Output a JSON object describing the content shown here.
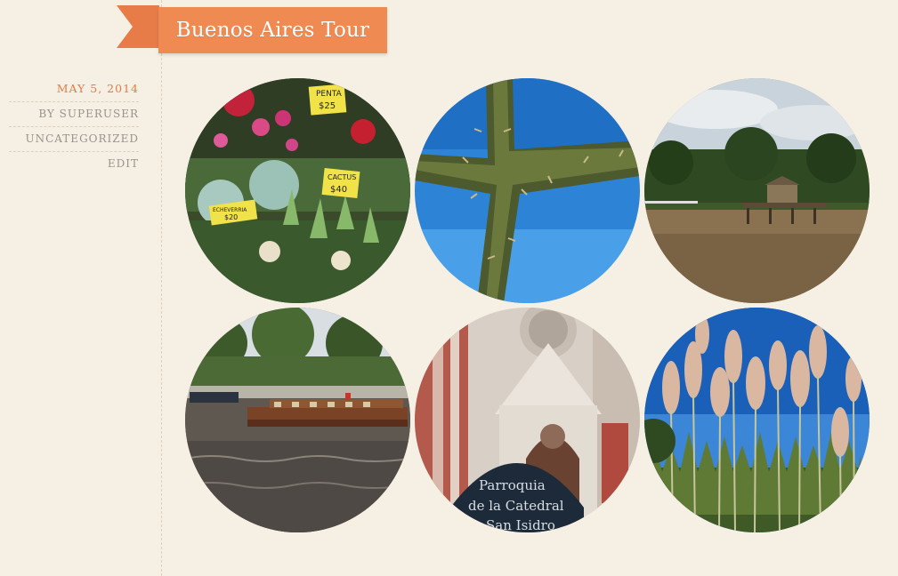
{
  "post": {
    "title": "Buenos Aires Tour",
    "date": "MAY 5, 2014",
    "author": "BY SUPERUSER",
    "category": "UNCATEGORIZED",
    "edit_label": "EDIT"
  },
  "gallery": {
    "items": [
      {
        "label": "flowers-market",
        "signs": [
          "PENTA",
          "$25",
          "CACTUS",
          "$40",
          "ECHEVERRIA",
          "$20"
        ]
      },
      {
        "label": "cactus-sky"
      },
      {
        "label": "river-dock"
      },
      {
        "label": "river-boat"
      },
      {
        "label": "cathedral",
        "sign": [
          "Parroquia",
          "de la Catedral",
          "San Isidro"
        ]
      },
      {
        "label": "pampas-grass"
      }
    ]
  },
  "colors": {
    "background": "#f5efe4",
    "ribbon": "#ef8a53",
    "date": "#e47b48",
    "meta": "#9a928c"
  }
}
